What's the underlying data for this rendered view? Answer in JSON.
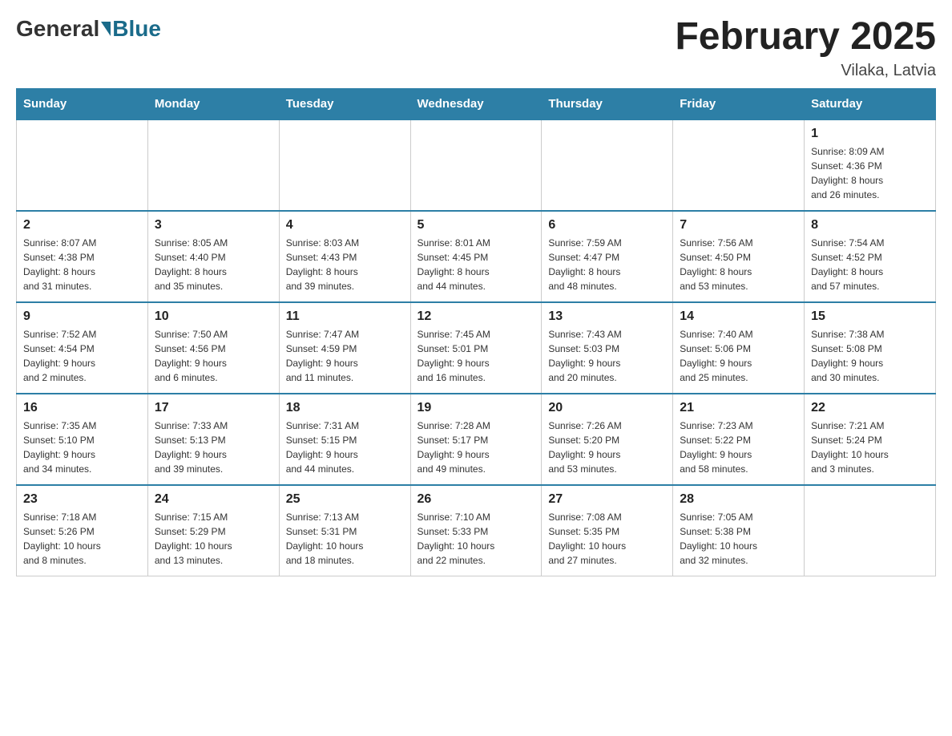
{
  "header": {
    "logo_text_general": "General",
    "logo_text_blue": "Blue",
    "month_title": "February 2025",
    "location": "Vilaka, Latvia"
  },
  "days_of_week": [
    "Sunday",
    "Monday",
    "Tuesday",
    "Wednesday",
    "Thursday",
    "Friday",
    "Saturday"
  ],
  "weeks": [
    {
      "days": [
        {
          "num": "",
          "info": ""
        },
        {
          "num": "",
          "info": ""
        },
        {
          "num": "",
          "info": ""
        },
        {
          "num": "",
          "info": ""
        },
        {
          "num": "",
          "info": ""
        },
        {
          "num": "",
          "info": ""
        },
        {
          "num": "1",
          "info": "Sunrise: 8:09 AM\nSunset: 4:36 PM\nDaylight: 8 hours\nand 26 minutes."
        }
      ]
    },
    {
      "days": [
        {
          "num": "2",
          "info": "Sunrise: 8:07 AM\nSunset: 4:38 PM\nDaylight: 8 hours\nand 31 minutes."
        },
        {
          "num": "3",
          "info": "Sunrise: 8:05 AM\nSunset: 4:40 PM\nDaylight: 8 hours\nand 35 minutes."
        },
        {
          "num": "4",
          "info": "Sunrise: 8:03 AM\nSunset: 4:43 PM\nDaylight: 8 hours\nand 39 minutes."
        },
        {
          "num": "5",
          "info": "Sunrise: 8:01 AM\nSunset: 4:45 PM\nDaylight: 8 hours\nand 44 minutes."
        },
        {
          "num": "6",
          "info": "Sunrise: 7:59 AM\nSunset: 4:47 PM\nDaylight: 8 hours\nand 48 minutes."
        },
        {
          "num": "7",
          "info": "Sunrise: 7:56 AM\nSunset: 4:50 PM\nDaylight: 8 hours\nand 53 minutes."
        },
        {
          "num": "8",
          "info": "Sunrise: 7:54 AM\nSunset: 4:52 PM\nDaylight: 8 hours\nand 57 minutes."
        }
      ]
    },
    {
      "days": [
        {
          "num": "9",
          "info": "Sunrise: 7:52 AM\nSunset: 4:54 PM\nDaylight: 9 hours\nand 2 minutes."
        },
        {
          "num": "10",
          "info": "Sunrise: 7:50 AM\nSunset: 4:56 PM\nDaylight: 9 hours\nand 6 minutes."
        },
        {
          "num": "11",
          "info": "Sunrise: 7:47 AM\nSunset: 4:59 PM\nDaylight: 9 hours\nand 11 minutes."
        },
        {
          "num": "12",
          "info": "Sunrise: 7:45 AM\nSunset: 5:01 PM\nDaylight: 9 hours\nand 16 minutes."
        },
        {
          "num": "13",
          "info": "Sunrise: 7:43 AM\nSunset: 5:03 PM\nDaylight: 9 hours\nand 20 minutes."
        },
        {
          "num": "14",
          "info": "Sunrise: 7:40 AM\nSunset: 5:06 PM\nDaylight: 9 hours\nand 25 minutes."
        },
        {
          "num": "15",
          "info": "Sunrise: 7:38 AM\nSunset: 5:08 PM\nDaylight: 9 hours\nand 30 minutes."
        }
      ]
    },
    {
      "days": [
        {
          "num": "16",
          "info": "Sunrise: 7:35 AM\nSunset: 5:10 PM\nDaylight: 9 hours\nand 34 minutes."
        },
        {
          "num": "17",
          "info": "Sunrise: 7:33 AM\nSunset: 5:13 PM\nDaylight: 9 hours\nand 39 minutes."
        },
        {
          "num": "18",
          "info": "Sunrise: 7:31 AM\nSunset: 5:15 PM\nDaylight: 9 hours\nand 44 minutes."
        },
        {
          "num": "19",
          "info": "Sunrise: 7:28 AM\nSunset: 5:17 PM\nDaylight: 9 hours\nand 49 minutes."
        },
        {
          "num": "20",
          "info": "Sunrise: 7:26 AM\nSunset: 5:20 PM\nDaylight: 9 hours\nand 53 minutes."
        },
        {
          "num": "21",
          "info": "Sunrise: 7:23 AM\nSunset: 5:22 PM\nDaylight: 9 hours\nand 58 minutes."
        },
        {
          "num": "22",
          "info": "Sunrise: 7:21 AM\nSunset: 5:24 PM\nDaylight: 10 hours\nand 3 minutes."
        }
      ]
    },
    {
      "days": [
        {
          "num": "23",
          "info": "Sunrise: 7:18 AM\nSunset: 5:26 PM\nDaylight: 10 hours\nand 8 minutes."
        },
        {
          "num": "24",
          "info": "Sunrise: 7:15 AM\nSunset: 5:29 PM\nDaylight: 10 hours\nand 13 minutes."
        },
        {
          "num": "25",
          "info": "Sunrise: 7:13 AM\nSunset: 5:31 PM\nDaylight: 10 hours\nand 18 minutes."
        },
        {
          "num": "26",
          "info": "Sunrise: 7:10 AM\nSunset: 5:33 PM\nDaylight: 10 hours\nand 22 minutes."
        },
        {
          "num": "27",
          "info": "Sunrise: 7:08 AM\nSunset: 5:35 PM\nDaylight: 10 hours\nand 27 minutes."
        },
        {
          "num": "28",
          "info": "Sunrise: 7:05 AM\nSunset: 5:38 PM\nDaylight: 10 hours\nand 32 minutes."
        },
        {
          "num": "",
          "info": ""
        }
      ]
    }
  ]
}
